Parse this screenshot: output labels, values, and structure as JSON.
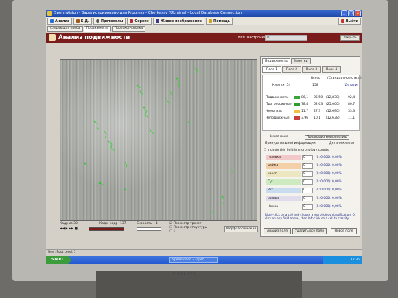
{
  "window": {
    "title": "SpermVision - Зарегистрировано для Progress - Cherkassy (Ukraine) - Local Database Connection"
  },
  "menu": [
    {
      "label": "Анализ",
      "icon": "analysis-icon",
      "color": "#2b6fd6"
    },
    {
      "label": "Б.Д.",
      "icon": "database-icon",
      "color": "#a35a1b"
    },
    {
      "label": "Протоколы",
      "icon": "search-icon",
      "color": "#555555"
    },
    {
      "label": "Сервис",
      "icon": "tools-icon",
      "color": "#b03030"
    },
    {
      "label": "Живое изображение",
      "icon": "camera-icon",
      "color": "#3a3a8a"
    },
    {
      "label": "Помощь",
      "icon": "help-icon",
      "color": "#d4a017"
    }
  ],
  "exit_label": "Выйти",
  "subtabs": [
    "Следующая проба",
    "Подвижность",
    "Протокол-кнопка"
  ],
  "header": {
    "title": "Анализ подвижности",
    "settings_label": "Исп. настройка:",
    "settings_value": "Ш",
    "close_label": "Закрыть"
  },
  "controls": {
    "frame_label": "Кадр из 30",
    "frames_label": "Кадр: кадр",
    "frames_value": "137",
    "speed_label": "Скорость",
    "speed_value": "1",
    "checkbox1": "Просмотр трекет",
    "checkbox2": "Просмотр структуры",
    "checkbox3": "1",
    "morph_button": "Морфологическая"
  },
  "right_panel": {
    "tabs": [
      "Подвижность",
      "Заметки"
    ],
    "fields_tabs": [
      "Поле 1",
      "Поле 2",
      "Поле 3",
      "Поле 4"
    ],
    "summary": {
      "all": "Всего",
      "std": "(Стандартное откл.)"
    },
    "cells_label": "Клетки: 54",
    "cells_value": "158",
    "detail_label": "(Детали)",
    "rows": [
      {
        "label": "Подвижность",
        "pct": "86,1",
        "val": "86,50",
        "paren": "(12,838)",
        "right": "92,4"
      },
      {
        "label": "Прогрессивные",
        "pct": "78,4",
        "val": "62,63",
        "paren": "(25,000)",
        "right": "80,7"
      },
      {
        "label": "Немотиль",
        "pct": "11,7",
        "val": "27,3",
        "paren": "(12,690)",
        "right": "33,3"
      },
      {
        "label": "Неподвижные",
        "pct": "3,96",
        "val": "10,1",
        "paren": "(12,638)",
        "right": "11,1"
      }
    ],
    "field_tab_name": "Имея поле",
    "morph_tab": "Проанализ морфологию",
    "all_info": "Принудительной информации",
    "detail_fields": "Детали клетки",
    "include_label": "Include this field in morphology counts",
    "morph_rows": [
      {
        "label": "головка",
        "value": "0",
        "stat": "(0: 0,000): 0,00%)",
        "color": "#f2c8c8"
      },
      {
        "label": "шейка",
        "value": "0",
        "stat": "(0: 0,000): 0,00%)",
        "color": "#f3d0a8"
      },
      {
        "label": "хвост",
        "value": "0",
        "stat": "(0: 0,000): 0,00%)",
        "color": "#ece7c0"
      },
      {
        "label": "Cyt",
        "value": "0",
        "stat": "(0: 0,000): 0,00%)",
        "color": "#cdeac0"
      },
      {
        "label": "Ркт",
        "value": "0",
        "stat": "(0: 0,000): 0,00%)",
        "color": "#c9dcef"
      },
      {
        "label": "разрыв",
        "value": "0",
        "stat": "(0: 0,000): 0,00%)",
        "color": "#e0dceb"
      },
      {
        "label": "Норма",
        "value": "0",
        "stat": "(0: 0,000): 0,00%)",
        "color": "#f5f3ee"
      }
    ],
    "hint": "Right-click on a cell and choose a morphology classification. Or click on any field above, then left-click on a cell to classify.",
    "buttons": [
      "Анализ поля",
      "Удалить все поля",
      "Новое поле"
    ]
  },
  "statusbar": "User: Root Level: 1",
  "taskbar": {
    "start": "START",
    "task": "SpermVision - Зарег...",
    "clock": "12:35"
  },
  "monitor_brand": "PHILIPS"
}
